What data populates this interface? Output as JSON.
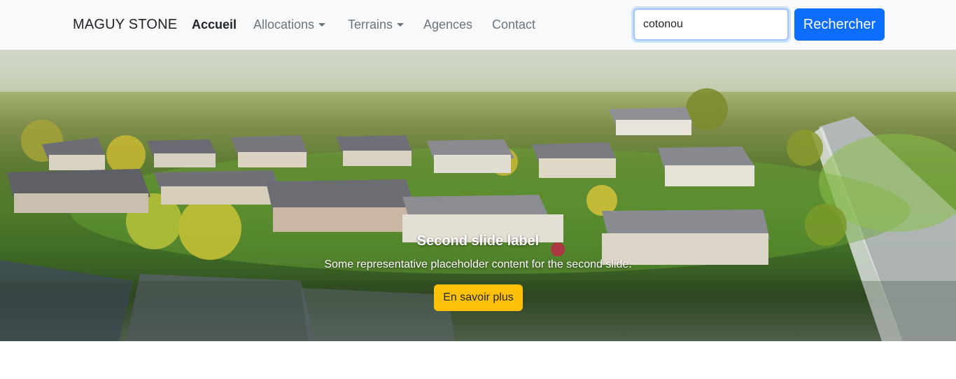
{
  "navbar": {
    "brand": "MAGUY STONE",
    "items": [
      {
        "label": "Accueil",
        "active": true,
        "dropdown": false
      },
      {
        "label": "Allocations",
        "active": false,
        "dropdown": true
      },
      {
        "label": "Terrains",
        "active": false,
        "dropdown": true
      },
      {
        "label": "Agences",
        "active": false,
        "dropdown": false
      },
      {
        "label": "Contact",
        "active": false,
        "dropdown": false
      }
    ],
    "search": {
      "value": "cotonou",
      "button_label": "Rechercher"
    }
  },
  "carousel": {
    "slide_title": "Second slide label",
    "slide_text": "Some representative placeholder content for the second slide.",
    "button_label": "En savoir plus",
    "image": "aerial-suburban-houses-tilt-shift"
  },
  "colors": {
    "primary": "#0d6efd",
    "warning": "#ffc107",
    "navbar_bg": "#f8f9fa"
  }
}
